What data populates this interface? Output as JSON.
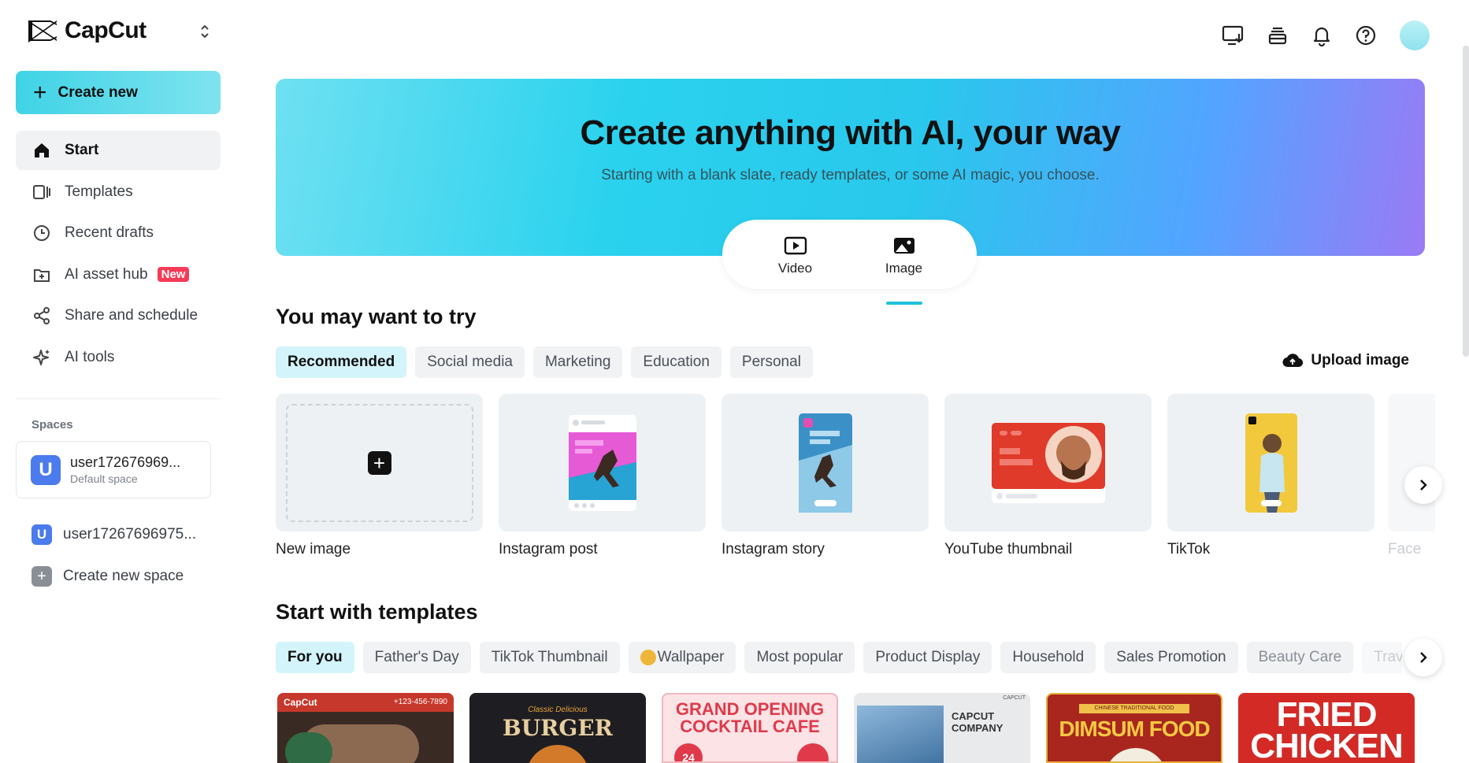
{
  "brand": {
    "name": "CapCut"
  },
  "sidebar": {
    "create_label": "Create new",
    "items": [
      {
        "label": "Start",
        "icon": "home-icon"
      },
      {
        "label": "Templates",
        "icon": "templates-icon"
      },
      {
        "label": "Recent drafts",
        "icon": "clock-icon"
      },
      {
        "label": "AI asset hub",
        "icon": "asset-hub-icon",
        "badge": "New"
      },
      {
        "label": "Share and schedule",
        "icon": "share-icon"
      },
      {
        "label": "AI tools",
        "icon": "sparkle-icon"
      }
    ],
    "spaces_label": "Spaces",
    "space_card": {
      "initial": "U",
      "name": "user172676969...",
      "sub": "Default space"
    },
    "space_row": {
      "initial": "U",
      "name": "user17267696975..."
    },
    "create_space_label": "Create new space"
  },
  "hero": {
    "title": "Create anything with AI, your way",
    "subtitle": "Starting with a blank slate, ready templates, or some AI magic, you choose.",
    "modes": [
      {
        "label": "Video"
      },
      {
        "label": "Image",
        "active": true
      }
    ]
  },
  "try_section": {
    "title": "You may want to try",
    "chips": [
      "Recommended",
      "Social media",
      "Marketing",
      "Education",
      "Personal"
    ],
    "upload_label": "Upload image",
    "cards": [
      {
        "title": "New image"
      },
      {
        "title": "Instagram post"
      },
      {
        "title": "Instagram story"
      },
      {
        "title": "YouTube thumbnail"
      },
      {
        "title": "TikTok"
      },
      {
        "title": "Facel"
      }
    ]
  },
  "templates_section": {
    "title": "Start with templates",
    "chips": [
      "For you",
      "Father's Day",
      "TikTok Thumbnail",
      "Wallpaper",
      "Most popular",
      "Product Display",
      "Household",
      "Sales Promotion",
      "Beauty Care",
      "Travel"
    ],
    "thumbs": [
      {
        "text": "CapCut",
        "sub": "+123-456-7890"
      },
      {
        "text": "BURGER",
        "sub": "Classic Delicious"
      },
      {
        "text": "GRAND OPENING COCKTAIL CAFE",
        "sub": "24"
      },
      {
        "text": "CAPCUT COMPANY",
        "sub": "CAPCUT"
      },
      {
        "text": "DIMSUM FOOD",
        "sub": "CHINESE TRADITIONAL FOOD"
      },
      {
        "text": "FRIED CHICKEN",
        "sub": ""
      }
    ]
  },
  "colors": {
    "accent": "#1fc0dd",
    "badge": "#f53b57",
    "chip_active": "#d4f4fb"
  }
}
